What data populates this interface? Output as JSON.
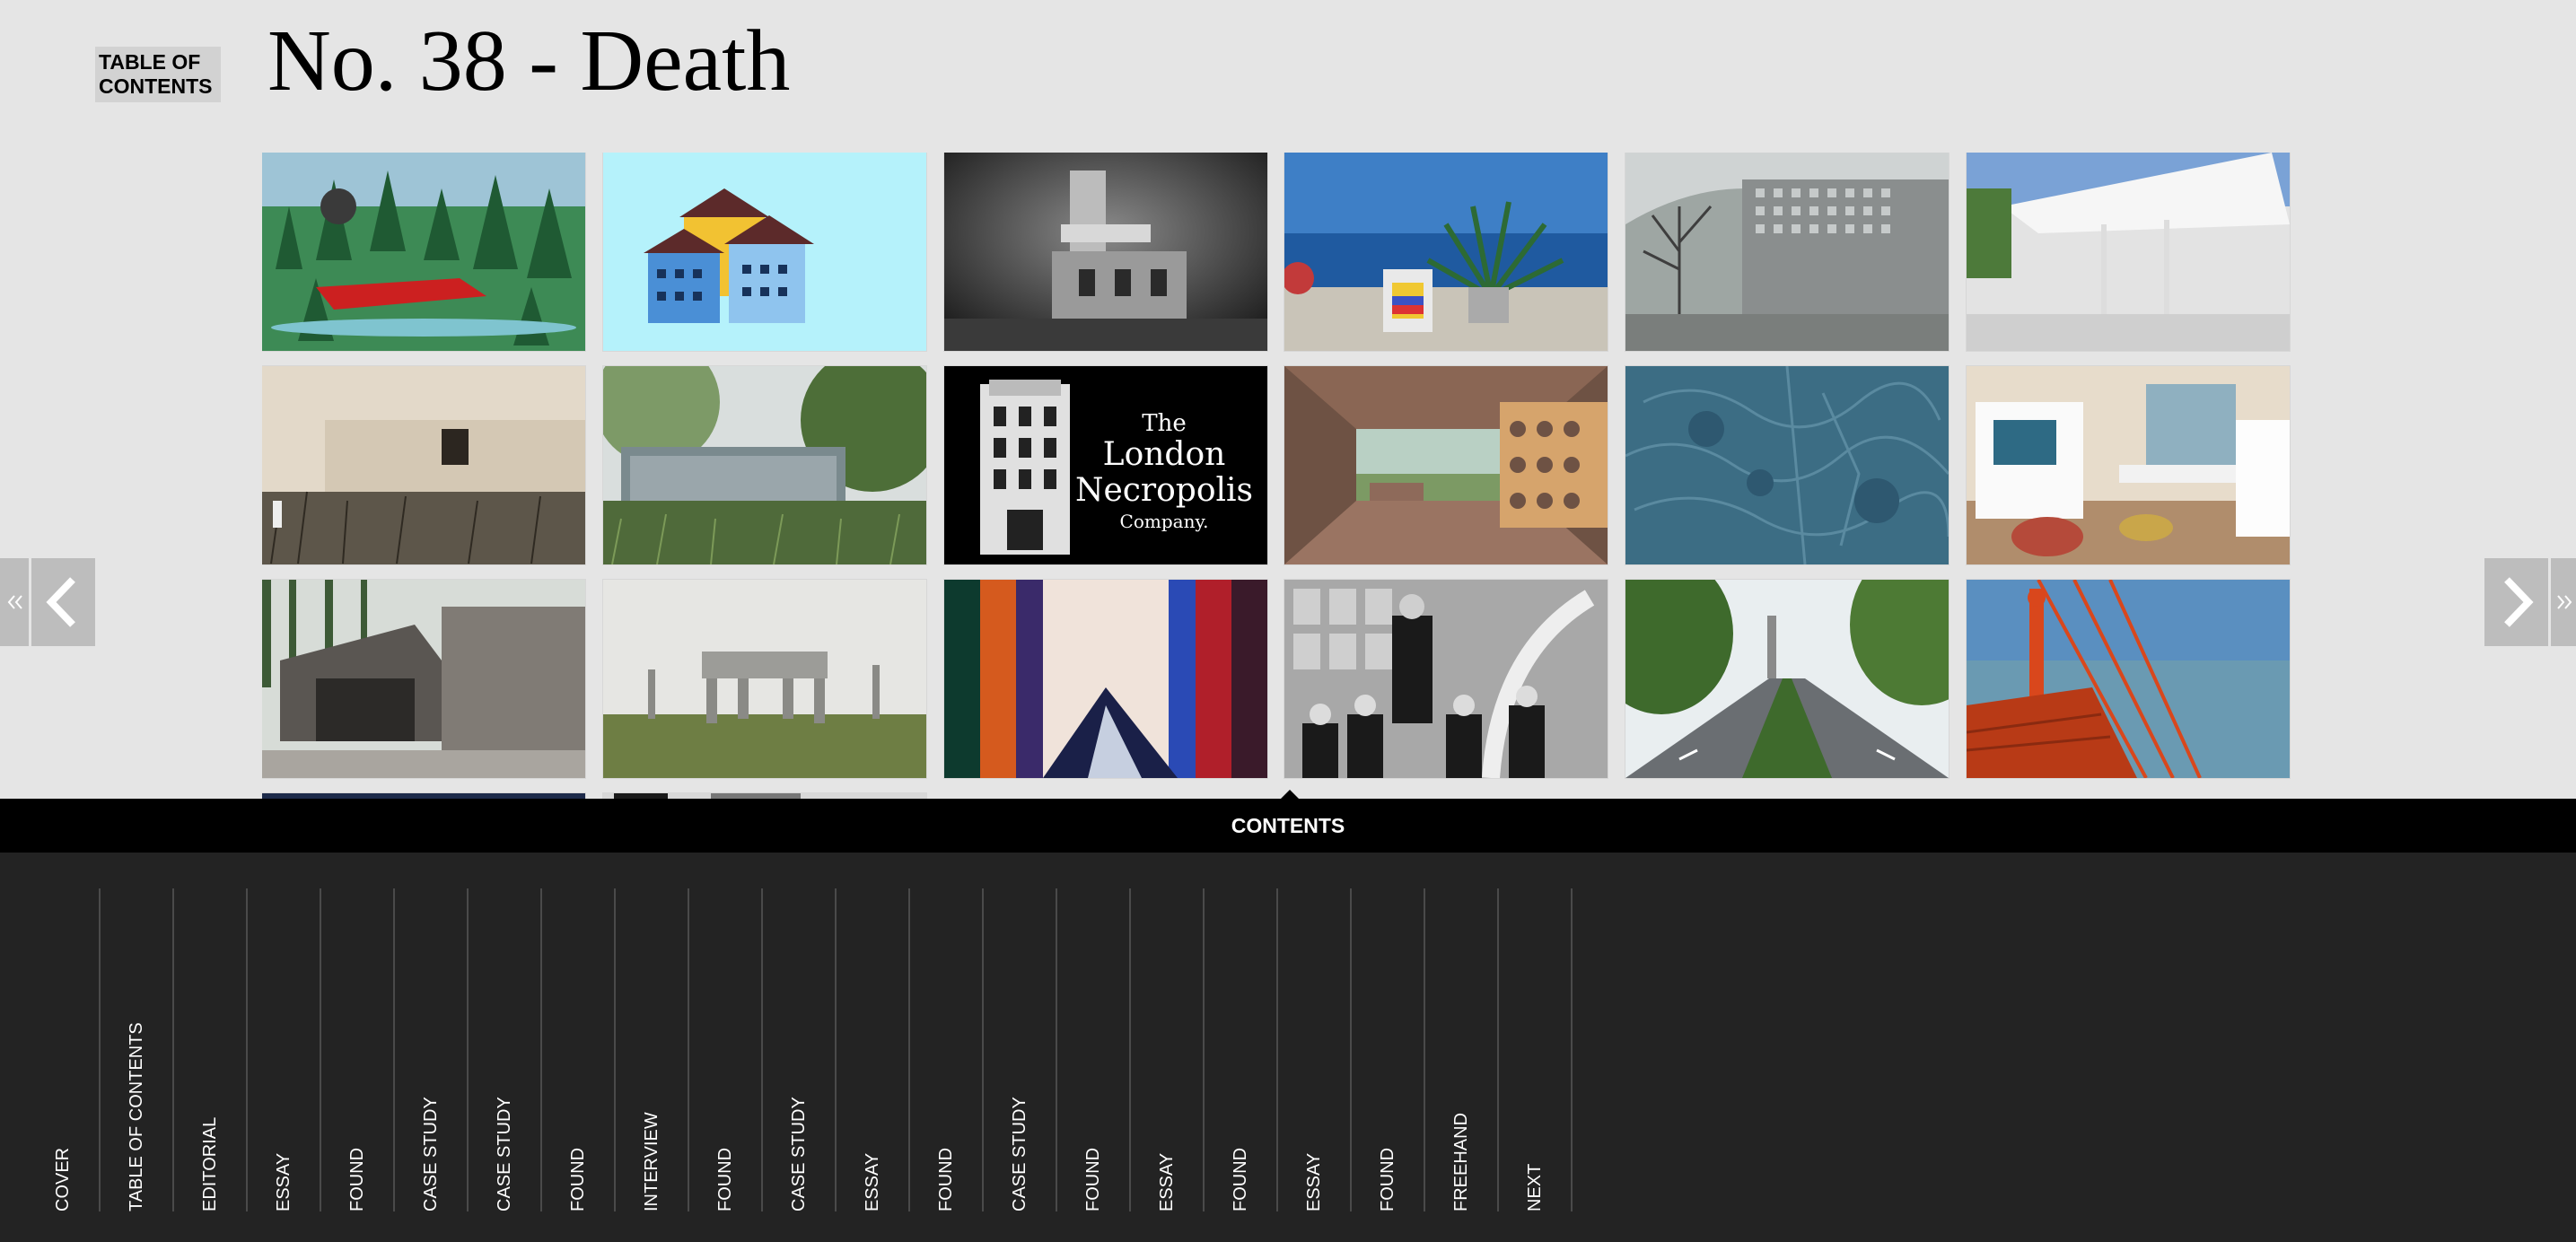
{
  "header": {
    "toc_button": "TABLE OF CONTENTS",
    "title": "No. 38 - Death"
  },
  "thumbnails": [
    {
      "id": "forest-painting-icon"
    },
    {
      "id": "toy-houses-icon"
    },
    {
      "id": "ruined-tower-icon"
    },
    {
      "id": "agave-terrace-icon"
    },
    {
      "id": "concrete-wall-icon"
    },
    {
      "id": "white-pavilion-icon"
    },
    {
      "id": "old-photo-wall-icon"
    },
    {
      "id": "glass-pavilion-forest-icon"
    },
    {
      "id": "london-necropolis-icon",
      "text": [
        "The",
        "London",
        "Necropolis",
        "Company."
      ]
    },
    {
      "id": "brick-interior-icon"
    },
    {
      "id": "blue-engraving-icon"
    },
    {
      "id": "kids-room-icon"
    },
    {
      "id": "concrete-chapel-icon"
    },
    {
      "id": "grey-monument-icon"
    },
    {
      "id": "color-stripes-icon"
    },
    {
      "id": "graduation-photo-icon"
    },
    {
      "id": "tree-lined-road-icon"
    },
    {
      "id": "golden-gate-bridge-icon"
    }
  ],
  "nav": {
    "first_icon": "double-chevron-left-icon",
    "prev_icon": "chevron-left-icon",
    "next_icon": "chevron-right-icon",
    "last_icon": "double-chevron-right-icon"
  },
  "contents": {
    "label": "CONTENTS",
    "items": [
      "COVER",
      "TABLE OF CONTENTS",
      "EDITORIAL",
      "ESSAY",
      "FOUND",
      "CASE STUDY",
      "CASE STUDY",
      "FOUND",
      "INTERVIEW",
      "FOUND",
      "CASE STUDY",
      "ESSAY",
      "FOUND",
      "CASE STUDY",
      "FOUND",
      "ESSAY",
      "FOUND",
      "ESSAY",
      "FOUND",
      "FREEHAND",
      "NEXT"
    ]
  },
  "colors": {
    "page_bg": "#e5e5e5",
    "contents_bar": "#000000",
    "contents_panel": "#232323",
    "arrow_bg": "#bdbdbd"
  }
}
